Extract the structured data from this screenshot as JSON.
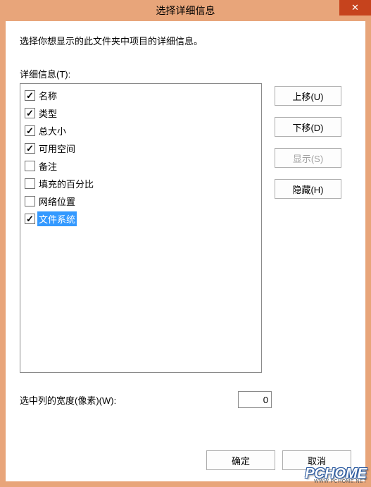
{
  "titlebar": {
    "title": "选择详细信息",
    "close": "✕"
  },
  "instruction": "选择你想显示的此文件夹中项目的详细信息。",
  "list_label": "详细信息(T):",
  "items": [
    {
      "label": "名称",
      "checked": true,
      "selected": false
    },
    {
      "label": "类型",
      "checked": true,
      "selected": false
    },
    {
      "label": "总大小",
      "checked": true,
      "selected": false
    },
    {
      "label": "可用空间",
      "checked": true,
      "selected": false
    },
    {
      "label": "备注",
      "checked": false,
      "selected": false
    },
    {
      "label": "填充的百分比",
      "checked": false,
      "selected": false
    },
    {
      "label": "网络位置",
      "checked": false,
      "selected": false
    },
    {
      "label": "文件系统",
      "checked": true,
      "selected": true
    }
  ],
  "buttons": {
    "move_up": "上移(U)",
    "move_down": "下移(D)",
    "show": "显示(S)",
    "hide": "隐藏(H)",
    "ok": "确定",
    "cancel": "取消"
  },
  "width": {
    "label": "选中列的宽度(像素)(W):",
    "value": "0"
  },
  "watermark": {
    "main": "PCHOME",
    "sub": "WWW.PCHOME.NET"
  }
}
